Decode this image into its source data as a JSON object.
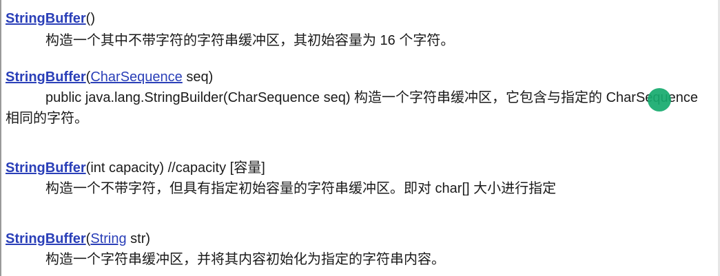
{
  "entries": [
    {
      "name": "StringBuffer",
      "sig_open": "()",
      "description": "构造一个其中不带字符的字符串缓冲区，其初始容量为 16 个字符。"
    },
    {
      "name": "StringBuffer",
      "paren_open": "(",
      "param_type": "CharSequence",
      "param_rest": " seq)",
      "description": "public java.lang.StringBuilder(CharSequence seq) 构造一个字符串缓冲区，它包含与指定的 CharSequence 相同的字符。"
    },
    {
      "name": "StringBuffer",
      "param_rest": "(int capacity)  //capacity [容量]",
      "description": "构造一个不带字符，但具有指定初始容量的字符串缓冲区。即对 char[] 大小进行指定"
    },
    {
      "name": "StringBuffer",
      "paren_open": "(",
      "param_type": "String",
      "param_rest": " str)",
      "description": "构造一个字符串缓冲区，并将其内容初始化为指定的字符串内容。"
    }
  ],
  "overlay": {
    "cursor_color": "#16aa6e"
  }
}
